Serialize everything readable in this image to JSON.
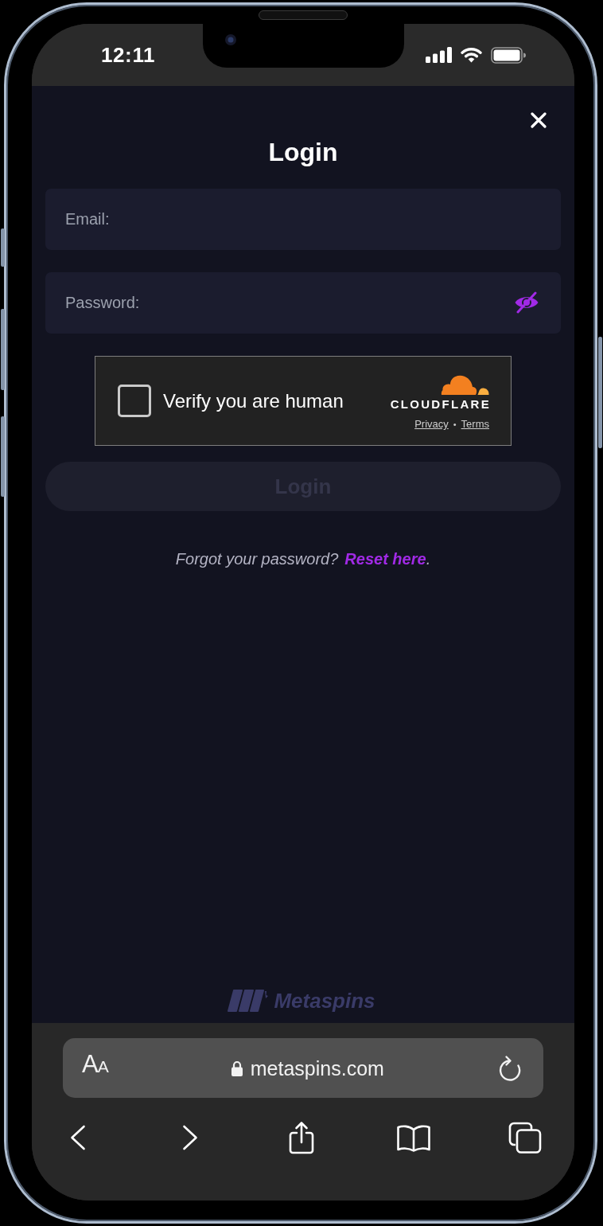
{
  "status_bar": {
    "time": "12:11"
  },
  "dialog": {
    "title": "Login",
    "fields": [
      {
        "kind": "email",
        "placeholder": "Email:"
      },
      {
        "kind": "password",
        "placeholder": "Password:",
        "password_visible": false
      }
    ],
    "captcha": {
      "label": "Verify you are human",
      "checked": false,
      "brand": "CLOUDFLARE",
      "links": [
        "Privacy",
        "Terms"
      ],
      "separator": "•"
    },
    "submit": {
      "label": "Login",
      "disabled": true
    },
    "reset_prompt": {
      "text": "Forgot your password?",
      "link": "Reset here",
      "after": "."
    },
    "footer_logo": {
      "text": "Metaspins"
    }
  },
  "browser": {
    "text_size_button": "AA",
    "url": "metaspins.com"
  }
}
